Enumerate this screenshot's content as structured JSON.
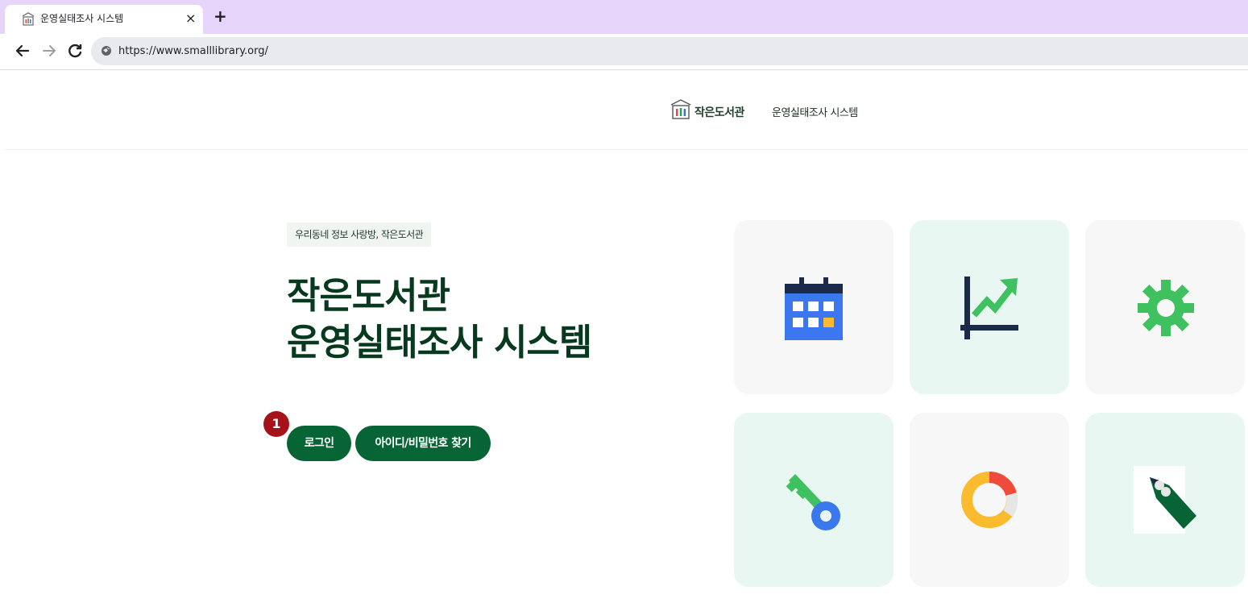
{
  "browser": {
    "tab_title": "운영실태조사 시스템",
    "tab_close": "×",
    "new_tab": "+",
    "url": "https://www.smalllibrary.org/"
  },
  "header": {
    "logo_text": "작은도서관",
    "subtitle": "운영실태조사 시스템"
  },
  "hero": {
    "tagline": "우리동네 정보 사랑방, 작은도서관",
    "title_line1": "작은도서관",
    "title_line2": "운영실태조사 시스템"
  },
  "buttons": {
    "login": "로그인",
    "find_account": "아이디/비밀번호 찾기"
  },
  "annotation": {
    "step": "1"
  },
  "cards": [
    {
      "icon": "calendar-icon",
      "bg": "#f7f7f7"
    },
    {
      "icon": "chart-icon",
      "bg": "#e8f7f1"
    },
    {
      "icon": "gear-icon",
      "bg": "#f7f7f7"
    },
    {
      "icon": "key-icon",
      "bg": "#e8f7f1"
    },
    {
      "icon": "donut-icon",
      "bg": "#f7f7f7"
    },
    {
      "icon": "pencil-icon",
      "bg": "#e8f7f1"
    }
  ],
  "colors": {
    "primary": "#066435",
    "tab_strip": "#e6d4fb",
    "title": "#07391e",
    "badge": "#a6111a"
  }
}
